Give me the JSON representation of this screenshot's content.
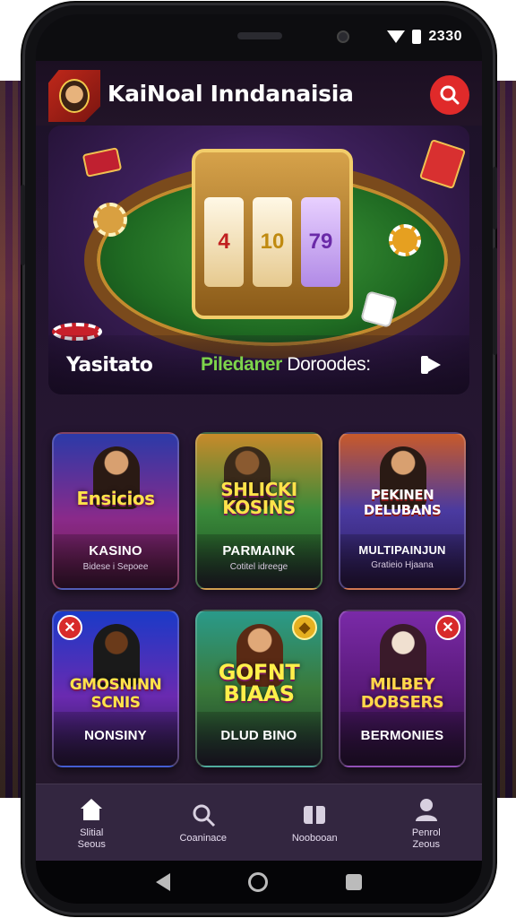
{
  "status_bar": {
    "time": "2330"
  },
  "header": {
    "title": "KaiNoal Inndanaisia",
    "search_icon": "search-icon"
  },
  "hero": {
    "left_label": "Yasitato",
    "right_label_green": "Piledaner",
    "right_label_rest": " Doroodes:",
    "reels": [
      "4",
      "10",
      "79"
    ],
    "colors": {
      "felt": "#2f8a30",
      "accent": "#f2cd6a"
    }
  },
  "games": [
    {
      "art_text": "Ensicios",
      "title": "KASINO",
      "subtitle": "Bidese i Sepoee",
      "badge": ""
    },
    {
      "art_text": "SHLICKI KOSINS",
      "title": "PARMAINK",
      "subtitle": "Cotitel idreege",
      "badge": ""
    },
    {
      "art_text": "PEKINEN DELUBANS",
      "title": "MULTIPAINJUN",
      "subtitle": "Gratieio Hjaana",
      "badge": ""
    },
    {
      "art_text": "GMOSNINN SCNIS",
      "title": "NONSINY",
      "subtitle": "",
      "badge": "x-left"
    },
    {
      "art_text": "GOFNT BIAAS",
      "title": "DLUD BINO",
      "subtitle": "",
      "badge": ""
    },
    {
      "art_text": "MILBEY DOBSERS",
      "title": "BERMONIES",
      "subtitle": "",
      "badge": "x-right"
    }
  ],
  "nav": [
    {
      "icon": "home-icon",
      "label": "Slitial\nSeous"
    },
    {
      "icon": "search-icon",
      "label": "Coaninace"
    },
    {
      "icon": "promo-icon",
      "label": "Noobooan"
    },
    {
      "icon": "user-icon",
      "label": "Penrol\nZeous"
    }
  ]
}
